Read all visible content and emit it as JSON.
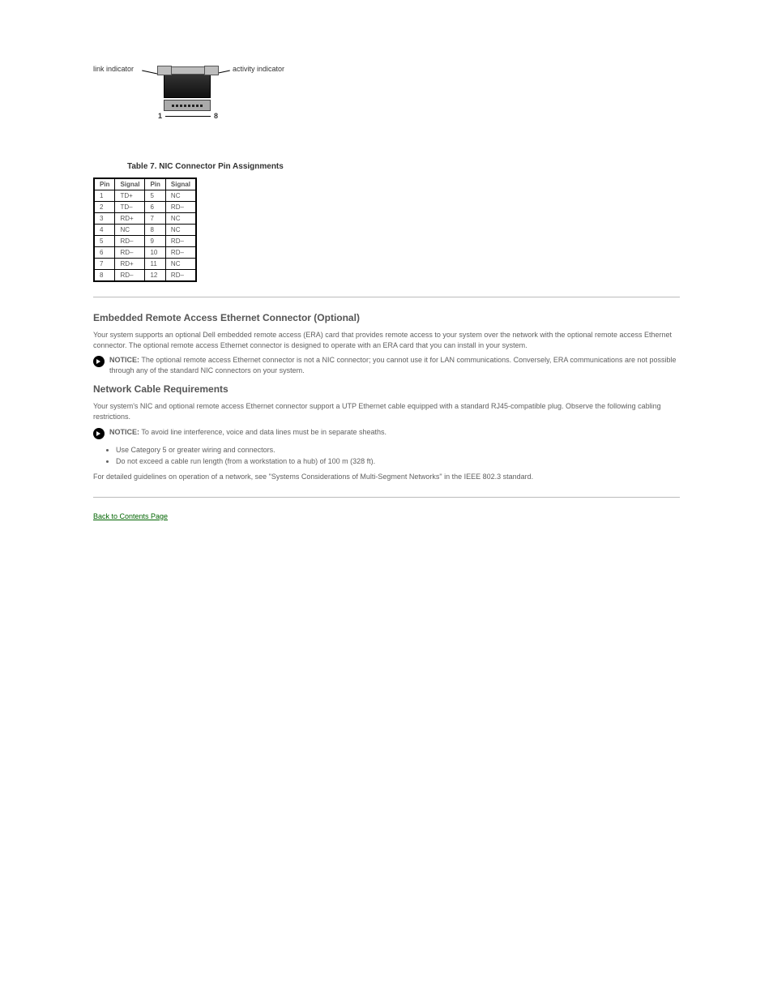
{
  "figure": {
    "link_label": "link indicator",
    "activity_label": "activity indicator",
    "pin_start": "1",
    "pin_end": "8"
  },
  "table": {
    "caption_prefix": "Table",
    "caption": "7. NIC Connector Pin Assignments",
    "headers": [
      "Pin",
      "Signal",
      "Pin",
      "Signal"
    ],
    "rows": [
      [
        "1",
        "TD+",
        "5",
        "NC"
      ],
      [
        "2",
        "TD–",
        "6",
        "RD–"
      ],
      [
        "3",
        "RD+",
        "7",
        "NC"
      ],
      [
        "4",
        "NC",
        "8",
        "NC"
      ],
      [
        "5",
        "RD–",
        "9",
        "RD–"
      ],
      [
        "6",
        "RD–",
        "10",
        "RD–"
      ],
      [
        "7",
        "RD+",
        "11",
        "NC"
      ],
      [
        "8",
        "RD–",
        "12",
        "RD–"
      ]
    ]
  },
  "section_embedded": {
    "title": "Embedded Remote Access Ethernet Connector (Optional)",
    "para": "Your system supports an optional Dell embedded remote access (ERA) card that provides remote access to your system over the network with the optional remote access Ethernet connector. The optional remote access Ethernet connector is designed to operate with an ERA card that you can install in your system.",
    "notice_label": "NOTICE:",
    "notice_text": "The optional remote access Ethernet connector is not a NIC connector; you cannot use it for LAN communications. Conversely, ERA communications are not possible through any of the standard NIC connectors on your system."
  },
  "section_cabling": {
    "title": "Network Cable Requirements",
    "para1": "Your system's NIC and optional remote access Ethernet connector support a UTP Ethernet cable equipped with a standard RJ45-compatible plug. Observe the following cabling restrictions.",
    "notice_label": "NOTICE:",
    "notice_text": "To avoid line interference, voice and data lines must be in separate sheaths.",
    "bullets": [
      "Use Category 5 or greater wiring and connectors.",
      "Do not exceed a cable run length (from a workstation to a hub) of 100 m (328 ft)."
    ],
    "para2": "For detailed guidelines on operation of a network, see \"Systems Considerations of Multi-Segment Networks\" in the IEEE 802.3 standard."
  },
  "back_link": "Back to Contents Page"
}
